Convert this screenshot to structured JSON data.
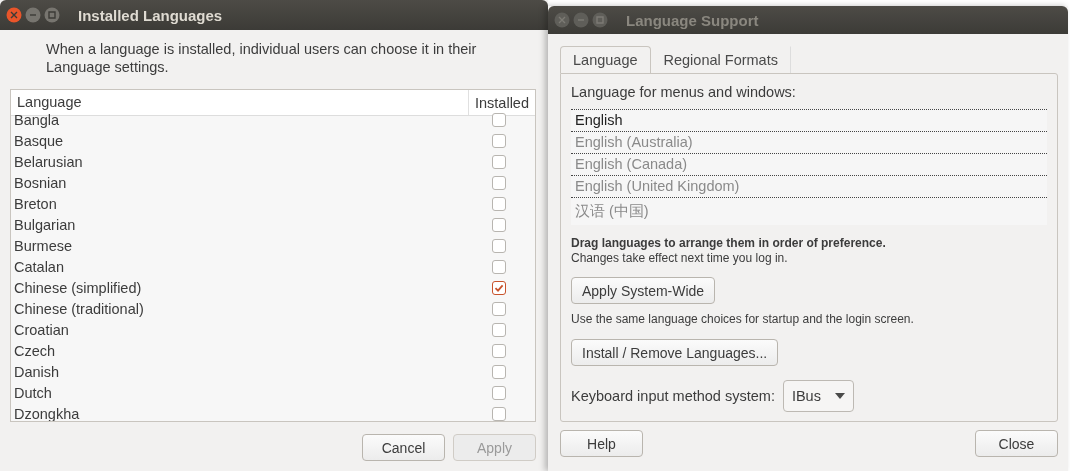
{
  "installed_window": {
    "title": "Installed Languages",
    "active": true,
    "intro": "When a language is installed, individual users can choose it in their Language settings.",
    "table": {
      "columns": [
        "Language",
        "Installed"
      ],
      "rows": [
        {
          "language": "Bangla",
          "checked": false
        },
        {
          "language": "Basque",
          "checked": false
        },
        {
          "language": "Belarusian",
          "checked": false
        },
        {
          "language": "Bosnian",
          "checked": false
        },
        {
          "language": "Breton",
          "checked": false
        },
        {
          "language": "Bulgarian",
          "checked": false
        },
        {
          "language": "Burmese",
          "checked": false
        },
        {
          "language": "Catalan",
          "checked": false
        },
        {
          "language": "Chinese (simplified)",
          "checked": true
        },
        {
          "language": "Chinese (traditional)",
          "checked": false
        },
        {
          "language": "Croatian",
          "checked": false
        },
        {
          "language": "Czech",
          "checked": false
        },
        {
          "language": "Danish",
          "checked": false
        },
        {
          "language": "Dutch",
          "checked": false
        },
        {
          "language": "Dzongkha",
          "checked": false
        }
      ]
    },
    "buttons": [
      {
        "label": "Cancel",
        "disabled": false
      },
      {
        "label": "Apply",
        "disabled": true
      }
    ]
  },
  "support_window": {
    "title": "Language Support",
    "active": false,
    "tabs": [
      {
        "label": "Language",
        "selected": true
      },
      {
        "label": "Regional Formats",
        "selected": false
      }
    ],
    "list_label": "Language for menus and windows:",
    "languages": [
      {
        "name": "English",
        "active": true
      },
      {
        "name": "English (Australia)",
        "active": false
      },
      {
        "name": "English (Canada)",
        "active": false
      },
      {
        "name": "English (United Kingdom)",
        "active": false
      },
      {
        "name": "汉语 (中国)",
        "active": false
      }
    ],
    "hint_bold": "Drag languages to arrange them in order of preference.",
    "hint": "Changes take effect next time you log in.",
    "apply_button": "Apply System-Wide",
    "apply_note": "Use the same language choices for startup and the login screen.",
    "install_button": "Install / Remove Languages...",
    "input_label": "Keyboard input method system:",
    "input_value": "IBus",
    "buttons": [
      {
        "label": "Help",
        "disabled": false
      },
      {
        "label": "Close",
        "disabled": false
      }
    ]
  }
}
